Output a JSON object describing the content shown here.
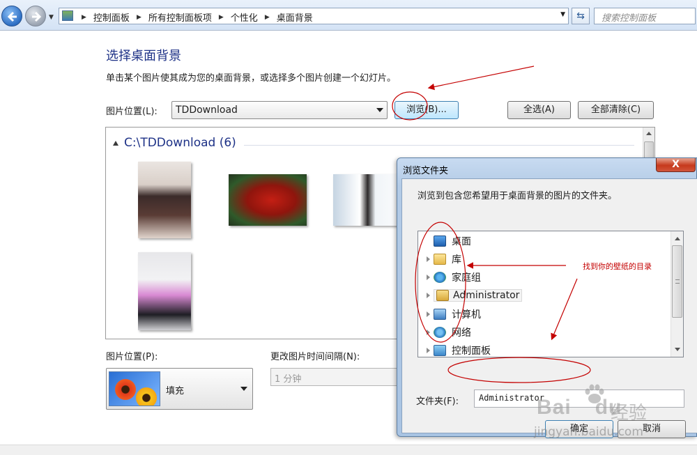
{
  "addressbar": {
    "breadcrumbs": [
      "控制面板",
      "所有控制面板项",
      "个性化",
      "桌面背景"
    ],
    "search_placeholder": "搜索控制面板"
  },
  "main": {
    "title": "选择桌面背景",
    "description": "单击某个图片使其成为您的桌面背景，或选择多个图片创建一个幻灯片。",
    "location_label": "图片位置(L):",
    "location_value": "TDDownload",
    "browse_button": "浏览(B)...",
    "select_all_button": "全选(A)",
    "clear_all_button": "全部清除(C)",
    "gallery_group_title": "C:\\TDDownload (6)",
    "position_label": "图片位置(P):",
    "position_value": "填充",
    "interval_label": "更改图片时间间隔(N):",
    "interval_value": "1 分钟"
  },
  "dialog": {
    "title": "浏览文件夹",
    "close_glyph": "X",
    "description": "浏览到包含您希望用于桌面背景的图片的文件夹。",
    "tree_items": [
      "桌面",
      "库",
      "家庭组",
      "Administrator",
      "计算机",
      "网络",
      "控制面板"
    ],
    "folder_label": "文件夹(F):",
    "folder_value": "Administrator",
    "ok_button": "确定",
    "cancel_button": "取消"
  },
  "annotation": {
    "note": "找到你的壁纸的目录",
    "color": "#c40000"
  },
  "watermark": {
    "brand": "Bai",
    "brand_suffix": "du",
    "product": "经验",
    "url": "jingyan.baidu.com"
  }
}
